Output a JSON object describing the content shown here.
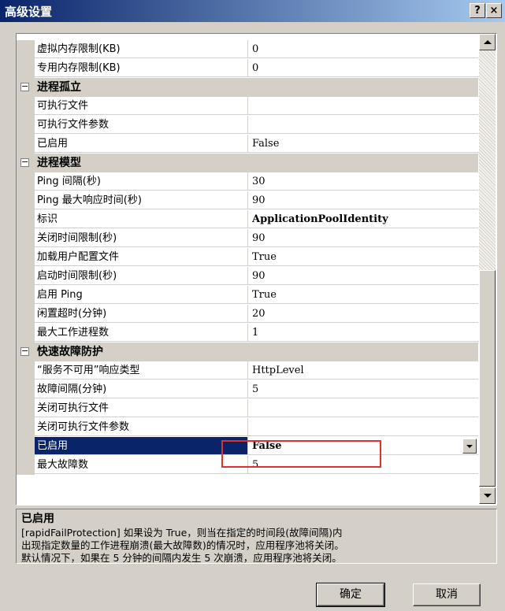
{
  "window": {
    "title": "高级设置",
    "help_label": "?",
    "close_label": "×"
  },
  "rows": [
    {
      "type": "prop",
      "name": "虚拟内存限制(KB)",
      "value": "0"
    },
    {
      "type": "prop",
      "name": "专用内存限制(KB)",
      "value": "0"
    },
    {
      "type": "cat",
      "label": "进程孤立",
      "toggle": "−"
    },
    {
      "type": "prop",
      "name": "可执行文件",
      "value": ""
    },
    {
      "type": "prop",
      "name": "可执行文件参数",
      "value": ""
    },
    {
      "type": "prop",
      "name": "已启用",
      "value": "False"
    },
    {
      "type": "cat",
      "label": "进程模型",
      "toggle": "−"
    },
    {
      "type": "prop",
      "name": "Ping 间隔(秒)",
      "value": "30"
    },
    {
      "type": "prop",
      "name": "Ping 最大响应时间(秒)",
      "value": "90"
    },
    {
      "type": "prop",
      "name": "标识",
      "value": "ApplicationPoolIdentity",
      "bold": true
    },
    {
      "type": "prop",
      "name": "关闭时间限制(秒)",
      "value": "90"
    },
    {
      "type": "prop",
      "name": "加载用户配置文件",
      "value": "True"
    },
    {
      "type": "prop",
      "name": "启动时间限制(秒)",
      "value": "90"
    },
    {
      "type": "prop",
      "name": "启用 Ping",
      "value": "True"
    },
    {
      "type": "prop",
      "name": "闲置超时(分钟)",
      "value": "20"
    },
    {
      "type": "prop",
      "name": "最大工作进程数",
      "value": "1"
    },
    {
      "type": "cat",
      "label": "快速故障防护",
      "toggle": "−"
    },
    {
      "type": "prop",
      "name": "“服务不可用”响应类型",
      "value": "HttpLevel"
    },
    {
      "type": "prop",
      "name": "故障间隔(分钟)",
      "value": "5"
    },
    {
      "type": "prop",
      "name": "关闭可执行文件",
      "value": ""
    },
    {
      "type": "prop",
      "name": "关闭可执行文件参数",
      "value": ""
    },
    {
      "type": "prop",
      "name": "已启用",
      "value": "False",
      "selected": true
    },
    {
      "type": "prop",
      "name": "最大故障数",
      "value": "5"
    }
  ],
  "description": {
    "title": "已启用",
    "lines": [
      "[rapidFailProtection] 如果设为 True，则当在指定的时间段(故障间隔)内",
      "出现指定数量的工作进程崩溃(最大故障数)的情况时，应用程序池将关闭。",
      "默认情况下，如果在 5 分钟的间隔内发生 5 次崩溃，应用程序池将关闭。"
    ]
  },
  "buttons": {
    "ok": "确定",
    "cancel": "取消"
  },
  "colors": {
    "selection": "#0a246a",
    "highlight_box": "#e03030",
    "face": "#d4d0c8"
  }
}
